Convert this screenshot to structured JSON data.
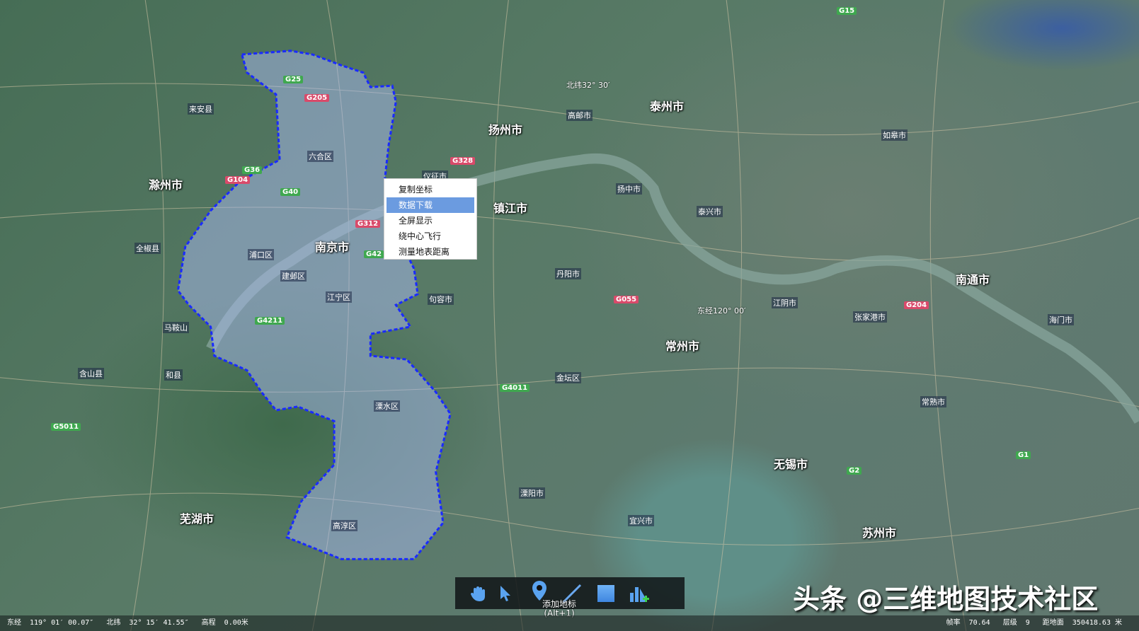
{
  "context_menu": {
    "items": [
      "复制坐标",
      "数据下载",
      "全屏显示",
      "绕中心飞行",
      "测量地表距离"
    ],
    "selected_index": 1
  },
  "toolbar": {
    "tools": [
      "pan",
      "select",
      "add-placemark",
      "draw-line",
      "draw-polygon",
      "add-chart"
    ],
    "tooltip": "添加地标",
    "tooltip_shortcut": "(Alt+1)"
  },
  "status": {
    "lon_label": "东经",
    "lon": "119° 01′ 00.07″",
    "lat_label": "北纬",
    "lat": "32° 15′ 41.55″",
    "elev_label": "高程",
    "elev": "0.00米",
    "fps_label": "帧率",
    "fps": "70.64",
    "level_label": "层级",
    "level": "9",
    "dist_label": "距地面",
    "dist": "350418.63 米"
  },
  "graticule": {
    "lat": "北纬32° 30′",
    "lon": "东经120° 00′"
  },
  "cities": [
    "南京市",
    "扬州市",
    "镇江市",
    "泰州市",
    "常州市",
    "无锡市",
    "苏州市",
    "南通市",
    "滁州市",
    "芜湖市"
  ],
  "districts": [
    "六合区",
    "仪征市",
    "江宁区",
    "建邺区",
    "浦口区",
    "溧水区",
    "高淳区",
    "句容市",
    "丹阳市",
    "金坛区",
    "溧阳市",
    "宜兴市",
    "江阴市",
    "张家港市",
    "常熟市",
    "马鞍山",
    "和县",
    "含山县",
    "来安县",
    "全椒县",
    "海门市",
    "如皋市",
    "泰兴市",
    "扬中市",
    "高邮市"
  ],
  "roads": [
    "G25",
    "G205",
    "G40",
    "G36",
    "G104",
    "G312",
    "G4211",
    "G42",
    "G328",
    "G2",
    "G15",
    "G4011",
    "G5011",
    "G055",
    "G204",
    "G1"
  ],
  "watermark": "头条 @三维地图技术社区",
  "region_outline_color": "#1a2bff"
}
